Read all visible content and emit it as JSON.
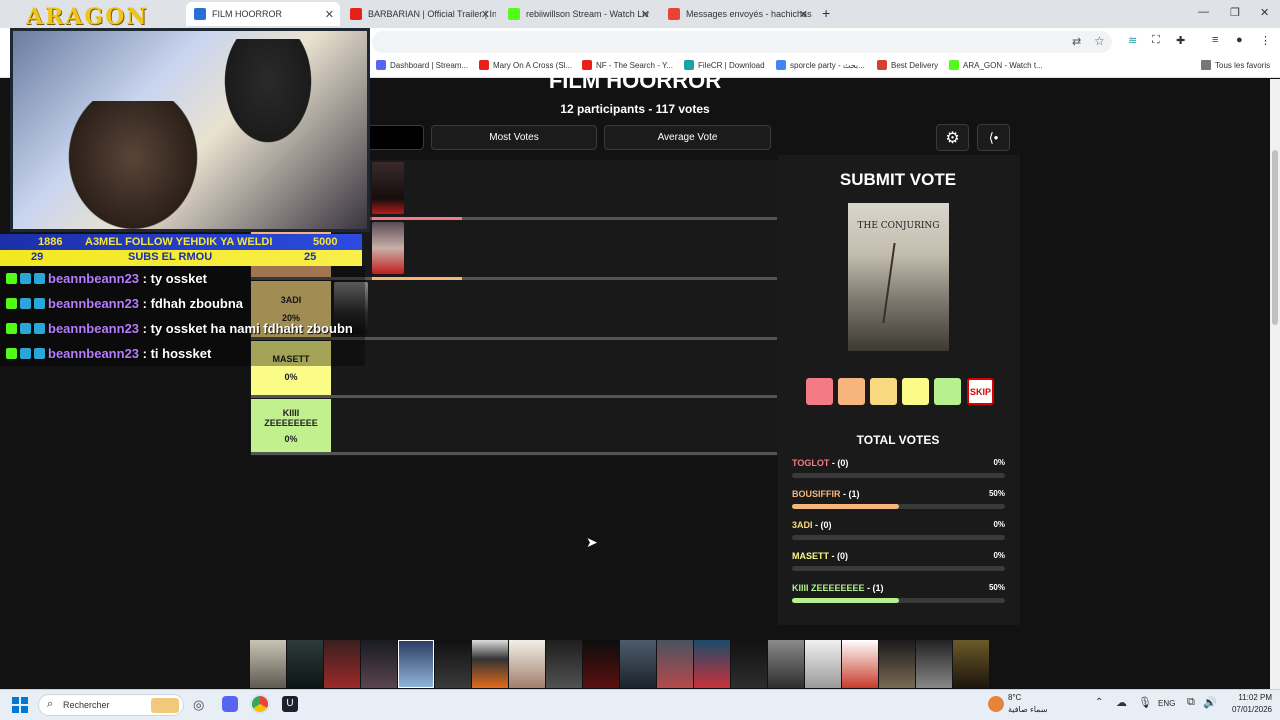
{
  "browser": {
    "tabs": [
      {
        "label": "FILM HOORROR",
        "color": "#2b6fd6",
        "active": true
      },
      {
        "label": "BARBARIAN | Official Trailer | In",
        "color": "#e62117"
      },
      {
        "label": "rebiiwillson Stream - Watch Liv",
        "color": "#53fc18"
      },
      {
        "label": "Messages envoyés - hachichas",
        "color": "#ea4335"
      }
    ],
    "new_tab": "+",
    "bookmarks": [
      {
        "label": "Dashboard | Stream...",
        "color": "#5865f2"
      },
      {
        "label": "Mary On A Cross (Sl...",
        "color": "#e62117"
      },
      {
        "label": "NF - The Search - Y...",
        "color": "#e62117"
      },
      {
        "label": "FileCR | Download",
        "color": "#1aa3a3"
      },
      {
        "label": "sporcle party - بحث...",
        "color": "#4285f4"
      },
      {
        "label": "Best Delivery",
        "color": "#d6402b"
      },
      {
        "label": "ARA_GON - Watch t...",
        "color": "#53fc18"
      }
    ],
    "all_bookmarks": "Tous les favoris"
  },
  "page": {
    "title": "FILM HOORROR",
    "subtitle": "12 participants - 117 votes",
    "sort_buttons": [
      "Most Votes",
      "Average Vote"
    ]
  },
  "tiers": [
    {
      "name": "",
      "pct": "",
      "color": "#f47b85",
      "fill": 0.17
    },
    {
      "name": "",
      "pct": "",
      "color": "#f5b57d",
      "fill": 0.17
    },
    {
      "name": "3ADI",
      "pct": "20%",
      "color": "#f8d980",
      "fill": 0
    },
    {
      "name": "MASETT",
      "pct": "0%",
      "color": "#fbfc87",
      "fill": 0
    },
    {
      "name": "KIIII ZEEEEEEEE",
      "pct": "0%",
      "color": "#c2f08e",
      "fill": 0
    }
  ],
  "submit": {
    "heading": "SUBMIT VOTE",
    "poster_title": "THE CONJURING",
    "skip_label": "SKIP",
    "vote_colors": [
      "#f47b85",
      "#f5b57d",
      "#f8d980",
      "#fbfc87",
      "#b7f08e"
    ]
  },
  "total_votes": {
    "heading": "TOTAL VOTES",
    "rows": [
      {
        "name": "TOGLOT",
        "count": " - (0)",
        "pct": "0%",
        "fraction": 0,
        "color": "#f47b85"
      },
      {
        "name": "BOUSIFFIR",
        "count": " - (1)",
        "pct": "50%",
        "fraction": 0.5,
        "color": "#f5b57d"
      },
      {
        "name": "3ADI",
        "count": " - (0)",
        "pct": "0%",
        "fraction": 0,
        "color": "#f8d980"
      },
      {
        "name": "MASETT",
        "count": " - (0)",
        "pct": "0%",
        "fraction": 0,
        "color": "#fbfc87"
      },
      {
        "name": "KIIII ZEEEEEEEE",
        "count": " - (1)",
        "pct": "50%",
        "fraction": 0.5,
        "color": "#b7f08e"
      }
    ]
  },
  "stream": {
    "logo": "ARAGON",
    "follow_count": "1886",
    "follow_text": "A3MEL FOLLOW YEHDIK YA WELDI",
    "follow_goal": "5000",
    "subs_count": "29",
    "subs_text": "SUBS EL RMOU",
    "subs_goal": "25",
    "chat": [
      {
        "user": "beannbeann23",
        "msg": " : ty ossket"
      },
      {
        "user": "beannbeann23",
        "msg": " : fdhah zboubna"
      },
      {
        "user": "beannbeann23",
        "msg": " : ty ossket ha nami fdhaht zboubn"
      },
      {
        "user": "beannbeann23",
        "msg": " : ti hossket"
      }
    ]
  },
  "taskbar": {
    "search": "Rechercher",
    "weather_temp": "8°C",
    "weather_desc": "سماء صافية",
    "lang": "ENG",
    "time": "11:02 PM",
    "date": "07/01/2026"
  }
}
